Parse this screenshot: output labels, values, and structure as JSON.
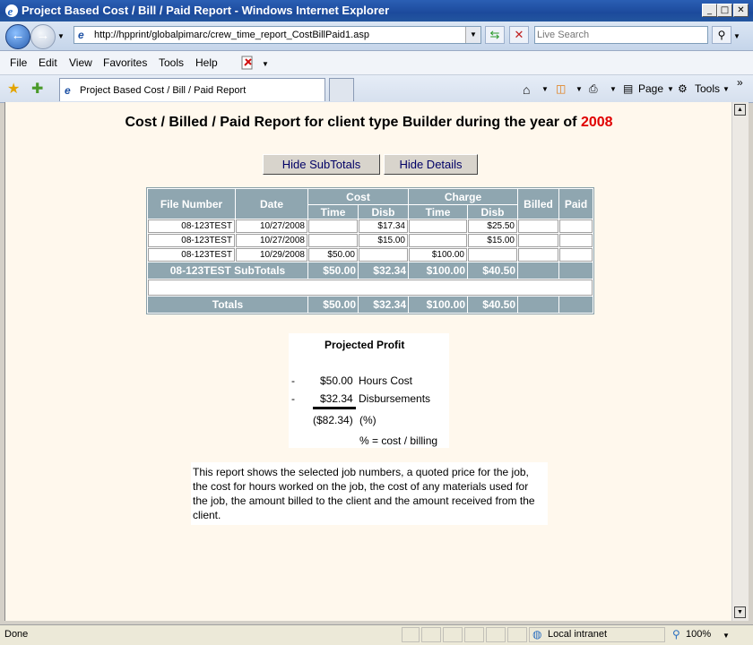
{
  "window": {
    "title": "Project Based Cost / Bill / Paid Report - Windows Internet Explorer"
  },
  "address": {
    "url": "http://hpprint/globalpimarc/crew_time_report_CostBillPaid1.asp"
  },
  "search": {
    "placeholder": "Live Search"
  },
  "menu": [
    "File",
    "Edit",
    "View",
    "Favorites",
    "Tools",
    "Help"
  ],
  "tab": {
    "label": "Project Based Cost / Bill / Paid Report"
  },
  "commands": {
    "page": "Page",
    "tools": "Tools"
  },
  "report": {
    "heading": "Cost / Billed / Paid Report for client type Builder during the year of ",
    "year": "2008",
    "buttons": {
      "hide_subtotals": "Hide SubTotals",
      "hide_details": "Hide Details"
    },
    "columns": {
      "file_number": "File Number",
      "date": "Date",
      "cost": "Cost",
      "charge": "Charge",
      "billed": "Billed",
      "paid": "Paid",
      "time": "Time",
      "disb": "Disb"
    },
    "rows": [
      {
        "file": "08-123TEST",
        "date": "10/27/2008",
        "cost_time": "",
        "cost_disb": "$17.34",
        "charge_time": "",
        "charge_disb": "$25.50",
        "billed": "",
        "paid": ""
      },
      {
        "file": "08-123TEST",
        "date": "10/27/2008",
        "cost_time": "",
        "cost_disb": "$15.00",
        "charge_time": "",
        "charge_disb": "$15.00",
        "billed": "",
        "paid": ""
      },
      {
        "file": "08-123TEST",
        "date": "10/29/2008",
        "cost_time": "$50.00",
        "cost_disb": "",
        "charge_time": "$100.00",
        "charge_disb": "",
        "billed": "",
        "paid": ""
      }
    ],
    "subtotal": {
      "label": "08-123TEST SubTotals",
      "cost_time": "$50.00",
      "cost_disb": "$32.34",
      "charge_time": "$100.00",
      "charge_disb": "$40.50",
      "billed": "",
      "paid": ""
    },
    "totals": {
      "label": "Totals",
      "cost_time": "$50.00",
      "cost_disb": "$32.34",
      "charge_time": "$100.00",
      "charge_disb": "$40.50",
      "billed": "",
      "paid": ""
    }
  },
  "profit": {
    "title": "Projected Profit",
    "dash": "-",
    "hours_cost": "$50.00",
    "hours_label": "Hours Cost",
    "disb_cost": "$32.34",
    "disb_label": "Disbursements",
    "result": "($82.34)",
    "pct": "(%)",
    "formula": "% = cost / billing"
  },
  "note": "This report shows the selected job numbers, a quoted price for the job, the cost for hours worked on the job, the cost of any materials used for the job, the amount billed to the client and the amount received from the client.",
  "status": {
    "text": "Done",
    "zone": "Local intranet",
    "zoom": "100%"
  }
}
